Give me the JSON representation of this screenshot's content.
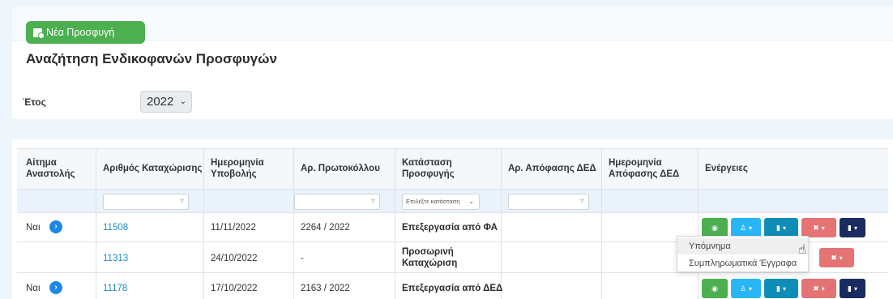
{
  "toolbar": {
    "new_appeal_label": "Νέα Προσφυγή"
  },
  "search": {
    "title": "Αναζήτηση Ενδικοφανών Προσφυγών",
    "year_label": "Έτος",
    "year_value": "2022"
  },
  "table": {
    "headers": [
      {
        "line1": "Αίτημα",
        "line2": "Αναστολής"
      },
      {
        "line1": "Αριθμός Καταχώρισης",
        "line2": ""
      },
      {
        "line1": "Ημερομηνία",
        "line2": "Υποβολής"
      },
      {
        "line1": "Αρ. Πρωτοκόλλου",
        "line2": ""
      },
      {
        "line1": "Κατάσταση",
        "line2": "Προσφυγής"
      },
      {
        "line1": "Αρ. Απόφασης ΔΕΔ",
        "line2": ""
      },
      {
        "line1": "Ημερομηνία",
        "line2": "Απόφασης ΔΕΔ"
      },
      {
        "line1": "Ενέργειες",
        "line2": ""
      }
    ],
    "status_filter_placeholder": "Επιλέξτε κατάσταση",
    "rows": [
      {
        "suspension": "Ναι",
        "reg_no": "11508",
        "date": "11/11/2022",
        "protocol": "2264 / 2022",
        "status1": "Επεξεργασία από ΦΑ",
        "status2": ""
      },
      {
        "suspension": "",
        "reg_no": "11313",
        "date": "24/10/2022",
        "protocol": "-",
        "status1": "Προσωρινή",
        "status2": "Καταχώριση"
      },
      {
        "suspension": "Ναι",
        "reg_no": "11178",
        "date": "17/10/2022",
        "protocol": "2163 / 2022",
        "status1": "Επεξεργασία από ΔΕΔ",
        "status2": ""
      }
    ]
  },
  "dropdown": {
    "items": [
      "Υπόμνημα",
      "Συμπληρωματικά Έγγραφα"
    ]
  },
  "colors": {
    "green": "#4caf50",
    "cyan": "#29b6f6",
    "teal": "#0e8db8",
    "red": "#e57373",
    "navy": "#1a2b5f",
    "link": "#1e8bc3"
  }
}
